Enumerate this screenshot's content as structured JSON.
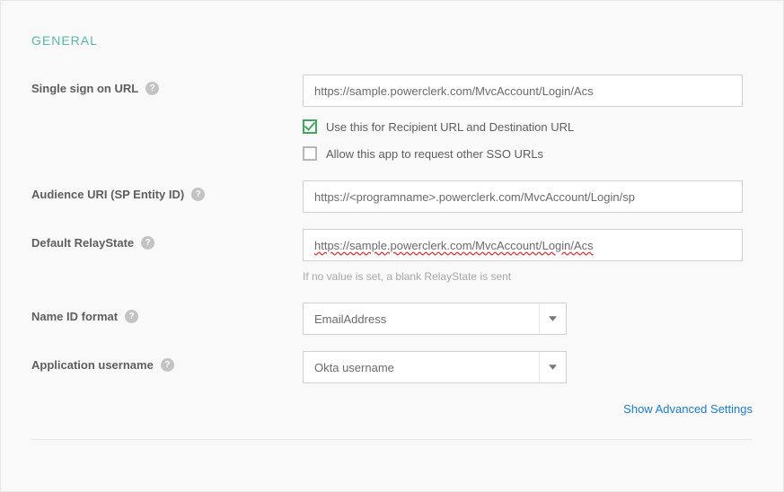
{
  "section_title": "GENERAL",
  "fields": {
    "sso_url": {
      "label": "Single sign on URL",
      "value": "https://sample.powerclerk.com/MvcAccount/Login/Acs",
      "checkbox1": {
        "label": "Use this for Recipient URL and Destination URL",
        "checked": true
      },
      "checkbox2": {
        "label": "Allow this app to request other SSO URLs",
        "checked": false
      }
    },
    "audience_uri": {
      "label": "Audience URI (SP Entity ID)",
      "value": "https://<programname>.powerclerk.com/MvcAccount/Login/sp"
    },
    "default_relaystate": {
      "label": "Default RelayState",
      "value": "https://sample.powerclerk.com/MvcAccount/Login/Acs",
      "hint": "If no value is set, a blank RelayState is sent"
    },
    "name_id_format": {
      "label": "Name ID format",
      "value": "EmailAddress"
    },
    "app_username": {
      "label": "Application username",
      "value": "Okta username"
    }
  },
  "advanced_link": "Show Advanced Settings",
  "help_glyph": "?"
}
